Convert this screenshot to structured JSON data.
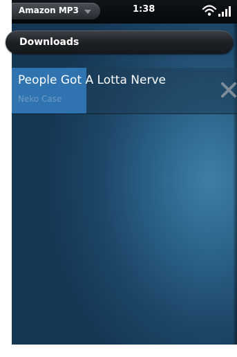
{
  "status_bar": {
    "app_name": "Amazon MP3",
    "time": "1:38",
    "icons": [
      "chevron-down-icon",
      "wifi-icon",
      "signal-icon"
    ]
  },
  "header": {
    "title": "Downloads"
  },
  "downloads": [
    {
      "title": "People Got A Lotta Nerve",
      "artist": "Neko Case",
      "progress": 0.33
    }
  ],
  "colors": {
    "background": "#1c4566",
    "progress": "#2f74b0",
    "artist_text": "#6f9cc4"
  }
}
